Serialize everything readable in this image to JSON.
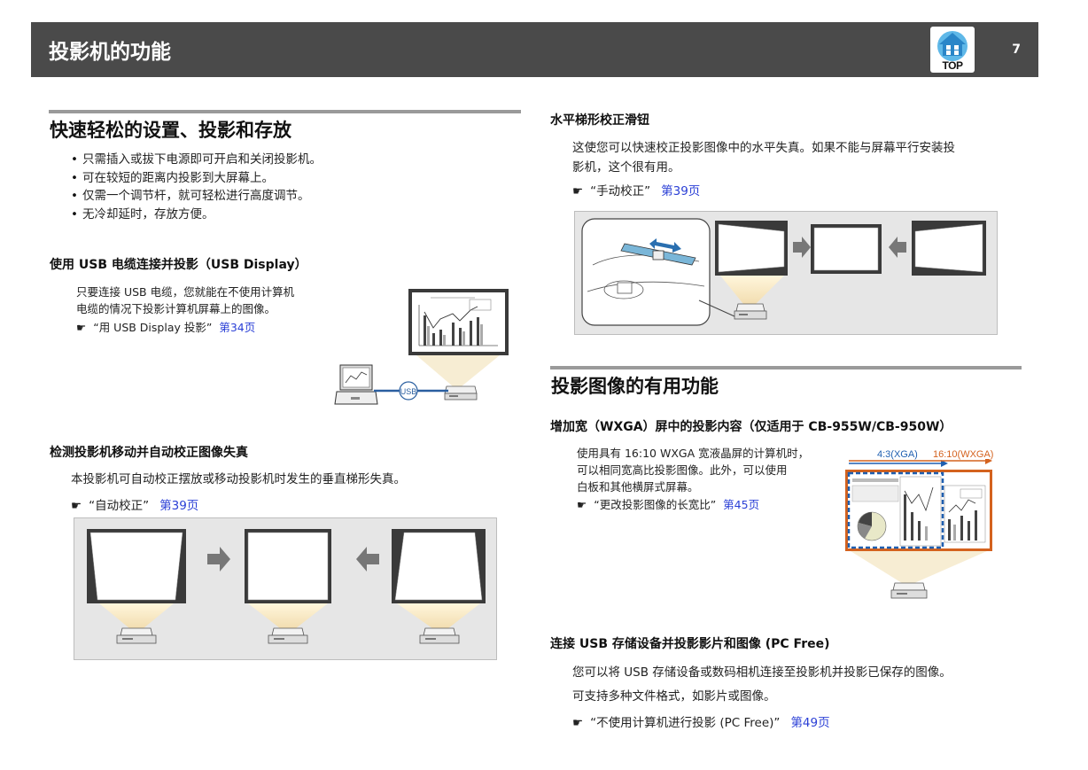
{
  "header": {
    "title": "投影机的功能",
    "page_number": "7",
    "top_label": "TOP"
  },
  "left": {
    "section1": {
      "title": "快速轻松的设置、投影和存放",
      "bullets": [
        "只需插入或拔下电源即可开启和关闭投影机。",
        "可在较短的距离内投影到大屏幕上。",
        "仅需一个调节杆，就可轻松进行高度调节。",
        "无冷却延时，存放方便。"
      ]
    },
    "usb_display": {
      "title": "使用  USB  电缆连接并投影（USB  Display）",
      "body_lines": [
        "只要连接 USB 电缆，您就能在不使用计算机",
        "电缆的情况下投影计算机屏幕上的图像。"
      ],
      "ref_text": "“用 USB Display 投影”",
      "ref_link": "第34页",
      "usb_label": "USB"
    },
    "auto_keystone": {
      "title": "检测投影机移动并自动校正图像失真",
      "body": "本投影机可自动校正摆放或移动投影机时发生的垂直梯形失真。",
      "ref_text": "“自动校正”",
      "ref_link": "第39页"
    }
  },
  "right": {
    "h_keystone": {
      "title": "水平梯形校正滑钮",
      "body_lines": [
        "这使您可以快速校正投影图像中的水平失真。如果不能与屏幕平行安装投",
        "影机，这个很有用。"
      ],
      "ref_text": "“手动校正”",
      "ref_link": "第39页"
    },
    "section2": {
      "title": "投影图像的有用功能"
    },
    "wxga": {
      "title": "增加宽（WXGA）屏中的投影内容（仅适用于  CB-955W/CB-950W）",
      "body_lines": [
        "使用具有 16:10 WXGA 宽液晶屏的计算机时，",
        "可以相同宽高比投影图像。此外，可以使用",
        "白板和其他横屏式屏幕。"
      ],
      "ref_text": "“更改投影图像的长宽比”",
      "ref_link": "第45页",
      "label_43": "4:3(XGA)",
      "label_1610": "16:10(WXGA)"
    },
    "pc_free": {
      "title": "连接  USB  存储设备并投影影片和图像  (PC  Free)",
      "body_lines": [
        "您可以将  USB  存储设备或数码相机连接至投影机并投影已保存的图像。",
        "可支持多种文件格式，如影片或图像。"
      ],
      "ref_text": "“不使用计算机进行投影  (PC  Free)”",
      "ref_link": "第49页"
    }
  },
  "icons": {
    "reference": "pointing-hand-icon",
    "top": "home-top-icon"
  },
  "colors": {
    "header_bg": "#4a4a4a",
    "link": "#2a3fd6",
    "rule": "#9a9a9a",
    "xga_blue": "#1f5fb0",
    "wxga_orange": "#d4621e"
  }
}
